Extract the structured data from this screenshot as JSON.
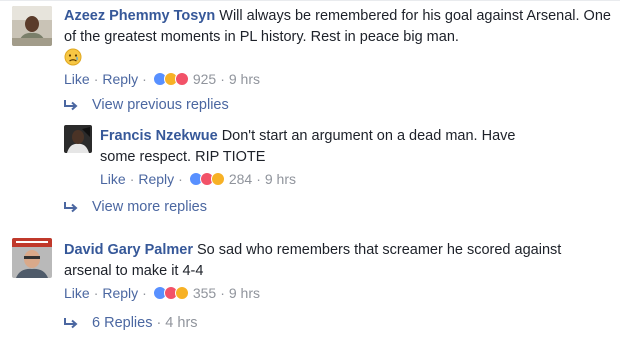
{
  "comments": [
    {
      "author": "Azeez Phemmy Tosyn",
      "text": "Will always be remembered for his goal against Arsenal. One of the greatest moments in PL history. Rest in peace big man.",
      "emoji": "sad-face-emoji",
      "like_label": "Like",
      "reply_label": "Reply",
      "reaction_count": "925",
      "time": "9 hrs",
      "reactions": [
        "like-reaction-icon",
        "sad-reaction-icon",
        "love-reaction-icon"
      ]
    },
    {
      "author": "Francis Nzekwue",
      "text": "Don't start an argument on a dead man. Have some respect. RIP TIOTE",
      "like_label": "Like",
      "reply_label": "Reply",
      "reaction_count": "284",
      "time": "9 hrs",
      "reactions": [
        "like-reaction-icon",
        "love-reaction-icon",
        "wow-reaction-icon"
      ]
    },
    {
      "author": "David Gary Palmer",
      "text": "So sad who remembers that screamer he scored against arsenal to make it 4-4",
      "like_label": "Like",
      "reply_label": "Reply",
      "reaction_count": "355",
      "time": "9 hrs",
      "reactions": [
        "like-reaction-icon",
        "love-reaction-icon",
        "sad-reaction-icon"
      ]
    }
  ],
  "view_previous_replies": "View previous replies",
  "view_more_replies": "View more replies",
  "replies_summary": {
    "label": "6 Replies",
    "time": "4 hrs"
  },
  "separator": "·",
  "colors": {
    "name": "#365899",
    "link": "#4b67a1",
    "meta": "#90949c",
    "like": "#5890ff",
    "love": "#f25268",
    "haha": "#f7b125"
  }
}
